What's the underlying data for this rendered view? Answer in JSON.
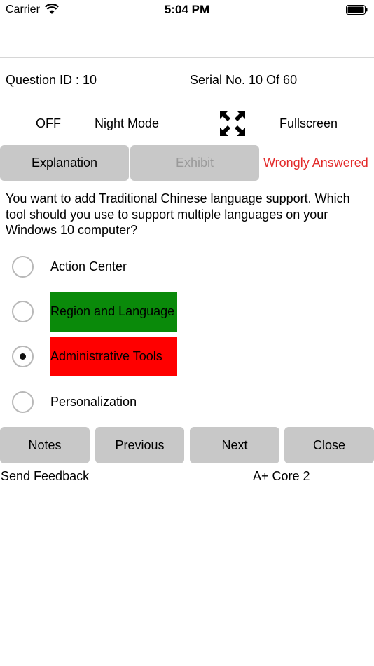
{
  "status_bar": {
    "carrier": "Carrier",
    "time": "5:04 PM"
  },
  "header": {
    "question_id": "Question ID : 10",
    "serial": "Serial No. 10 Of 60"
  },
  "modes": {
    "night_toggle": "OFF",
    "night_label": "Night Mode",
    "fullscreen_label": "Fullscreen",
    "fullscreen_icon": "expand-arrows-icon"
  },
  "actions": {
    "explanation": "Explanation",
    "exhibit": "Exhibit",
    "status": "Wrongly Answered",
    "status_color": "#e32b2b"
  },
  "question": {
    "text": "You want to add Traditional Chinese language support. Which tool should you use to support multiple languages on your Windows 10 computer?"
  },
  "options": [
    {
      "label": "Action Center",
      "selected": false,
      "state": "none"
    },
    {
      "label": "Region and Language",
      "selected": false,
      "state": "correct",
      "color": "#0a8a0a"
    },
    {
      "label": "Administrative Tools",
      "selected": true,
      "state": "wrong",
      "color": "#ff0000"
    },
    {
      "label": "Personalization",
      "selected": false,
      "state": "none"
    }
  ],
  "nav": {
    "notes": "Notes",
    "previous": "Previous",
    "next": "Next",
    "close": "Close"
  },
  "footer": {
    "feedback": "Send Feedback",
    "course": "A+ Core 2"
  }
}
